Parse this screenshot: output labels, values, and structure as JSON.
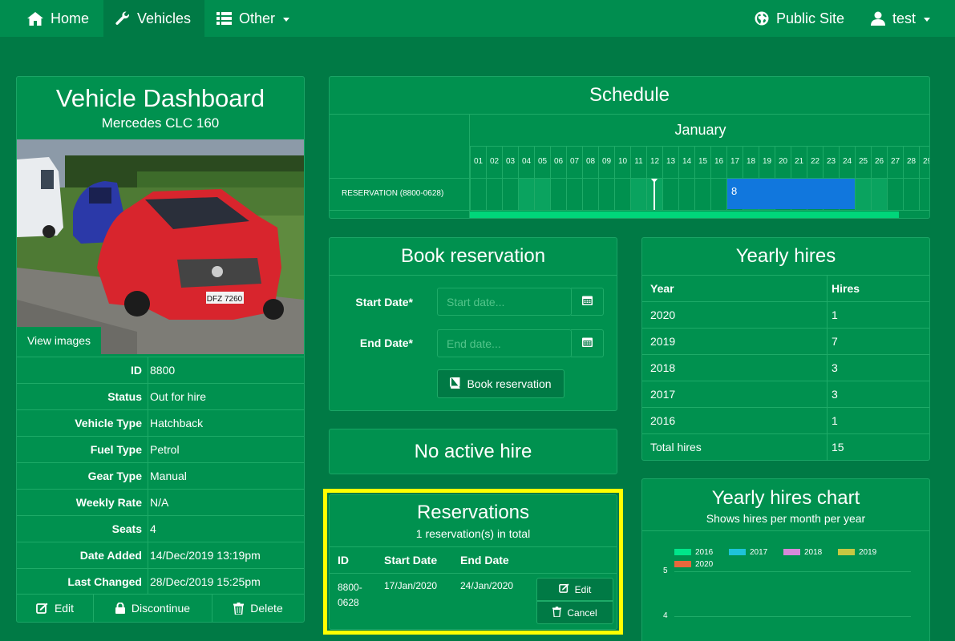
{
  "nav": {
    "home": "Home",
    "vehicles": "Vehicles",
    "other": "Other",
    "public_site": "Public Site",
    "user": "test"
  },
  "vehicle": {
    "title": "Vehicle Dashboard",
    "subtitle": "Mercedes CLC 160",
    "plate": "DFZ 7260",
    "view_images": "View images",
    "attributes": [
      {
        "label": "ID",
        "value": "8800"
      },
      {
        "label": "Status",
        "value": "Out for hire"
      },
      {
        "label": "Vehicle Type",
        "value": "Hatchback"
      },
      {
        "label": "Fuel Type",
        "value": "Petrol"
      },
      {
        "label": "Gear Type",
        "value": "Manual"
      },
      {
        "label": "Weekly Rate",
        "value": "N/A"
      },
      {
        "label": "Seats",
        "value": "4"
      },
      {
        "label": "Date Added",
        "value": "14/Dec/2019 13:19pm"
      },
      {
        "label": "Last Changed",
        "value": "28/Dec/2019 15:25pm"
      }
    ],
    "actions": {
      "edit": "Edit",
      "discontinue": "Discontinue",
      "delete": "Delete"
    }
  },
  "schedule": {
    "title": "Schedule",
    "month": "January",
    "days": [
      "01",
      "02",
      "03",
      "04",
      "05",
      "06",
      "07",
      "08",
      "09",
      "10",
      "11",
      "12",
      "13",
      "14",
      "15",
      "16",
      "17",
      "18",
      "19",
      "20",
      "21",
      "22",
      "23",
      "24",
      "25",
      "26",
      "27",
      "28",
      "29"
    ],
    "row_label": "RESERVATION (8800-0628)",
    "bar_label": "8",
    "bar_start_day": 17,
    "bar_end_day": 24,
    "today_day": 12,
    "scroll_fraction": 0.93
  },
  "book": {
    "title": "Book reservation",
    "start_label": "Start Date*",
    "start_placeholder": "Start date...",
    "end_label": "End Date*",
    "end_placeholder": "End date...",
    "button": "Book reservation"
  },
  "active_hire": {
    "title": "No active hire"
  },
  "reservations": {
    "title": "Reservations",
    "subtitle": "1 reservation(s) in total",
    "headers": {
      "id": "ID",
      "start": "Start Date",
      "end": "End Date"
    },
    "rows": [
      {
        "id_line1": "8800-",
        "id_line2": "0628",
        "start": "17/Jan/2020",
        "end": "24/Jan/2020",
        "edit": "Edit",
        "cancel": "Cancel"
      }
    ]
  },
  "yearly": {
    "title": "Yearly hires",
    "headers": {
      "year": "Year",
      "hires": "Hires"
    },
    "rows": [
      {
        "year": "2020",
        "hires": "1"
      },
      {
        "year": "2019",
        "hires": "7"
      },
      {
        "year": "2018",
        "hires": "3"
      },
      {
        "year": "2017",
        "hires": "3"
      },
      {
        "year": "2016",
        "hires": "1"
      },
      {
        "year": "Total hires",
        "hires": "15"
      }
    ]
  },
  "chart_panel": {
    "title": "Yearly hires chart",
    "subtitle": "Shows hires per month per year"
  },
  "chart_data": {
    "type": "line",
    "title": "Yearly hires chart",
    "subtitle": "Shows hires per month per year",
    "series": [
      {
        "name": "2016",
        "color": "#00e68a"
      },
      {
        "name": "2017",
        "color": "#1ec3d8"
      },
      {
        "name": "2018",
        "color": "#d689d9"
      },
      {
        "name": "2019",
        "color": "#c6c742"
      },
      {
        "name": "2020",
        "color": "#e8683c"
      }
    ],
    "y_ticks": [
      5,
      4
    ],
    "legend_position": "top",
    "grid": true
  }
}
